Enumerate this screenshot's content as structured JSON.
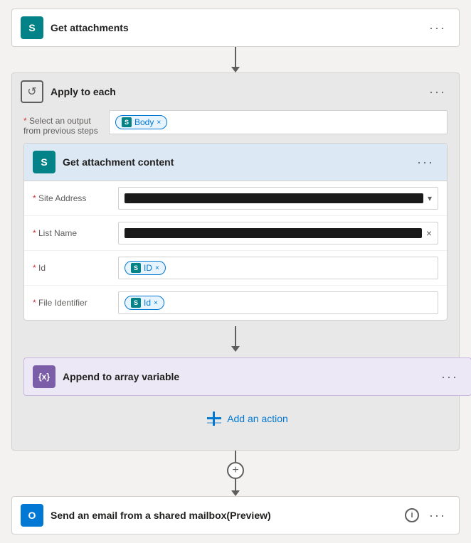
{
  "colors": {
    "sharepoint": "#038387",
    "outlook": "#0078d4",
    "variable": "#7b5ea7",
    "gray": "#6c6c6c",
    "text": "#201f1e",
    "secondary": "#605e5c",
    "border": "#d2d0ce",
    "accent": "#0078d4"
  },
  "steps": {
    "get_attachments": {
      "title": "Get attachments",
      "type": "sharepoint"
    },
    "apply_each": {
      "title": "Apply to each",
      "select_label": "* Select an output\nfrom previous steps",
      "token": "Body",
      "inner_card": {
        "title": "Get attachment content",
        "fields": [
          {
            "label": "* Site Address",
            "type": "redacted",
            "has_dropdown": true
          },
          {
            "label": "* List Name",
            "type": "redacted",
            "has_clear": true
          },
          {
            "label": "* Id",
            "token": "ID"
          },
          {
            "label": "* File Identifier",
            "token": "Id"
          }
        ]
      },
      "append_card": {
        "title": "Append to array variable"
      }
    },
    "add_action": {
      "label": "Add an action"
    },
    "send_email": {
      "title": "Send an email from a shared mailbox(Preview)"
    }
  }
}
